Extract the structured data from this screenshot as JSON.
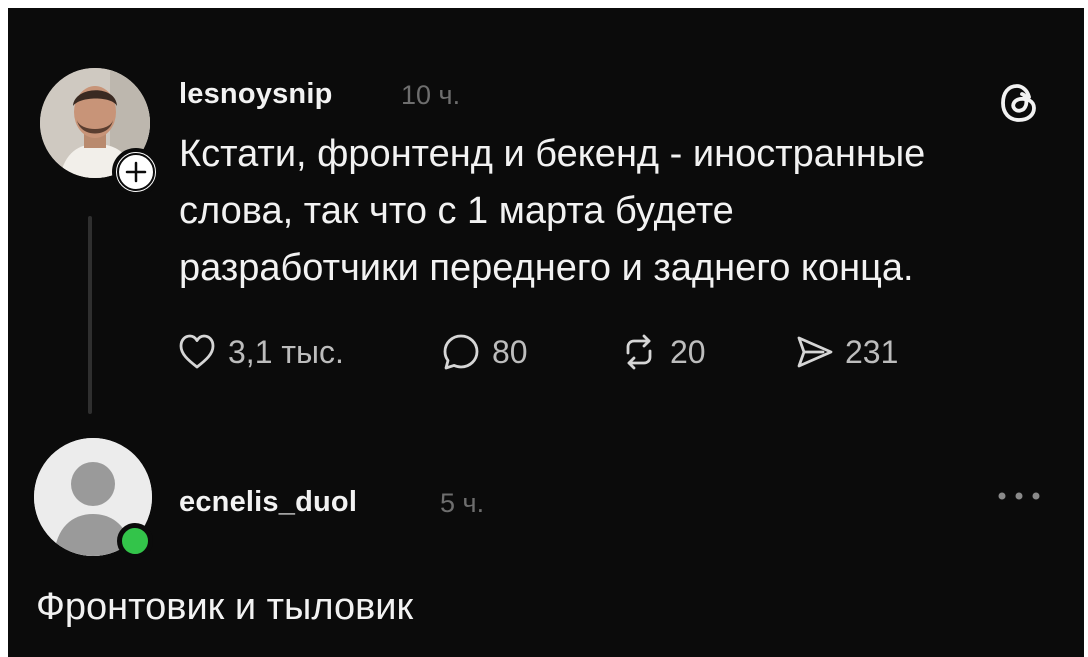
{
  "post": {
    "username": "lesnoysnip",
    "time": "10 ч.",
    "text_lines": [
      "Кстати, фронтенд и бекенд - иностранные",
      "слова, так что с 1 марта будете",
      "разработчики переднего и заднего конца."
    ],
    "actions": {
      "likes": "3,1 тыс.",
      "comments": "80",
      "reposts": "20",
      "shares": "231"
    },
    "app_icon": "threads-logo-icon"
  },
  "reply": {
    "username": "ecnelis_duol",
    "time": "5 ч.",
    "text": "Фронтовик и тыловик",
    "online_color": "#33c44a"
  },
  "colors": {
    "background": "#0b0b0b",
    "text": "#f2f2f2",
    "muted": "#6e6e6e",
    "online": "#33c44a"
  }
}
